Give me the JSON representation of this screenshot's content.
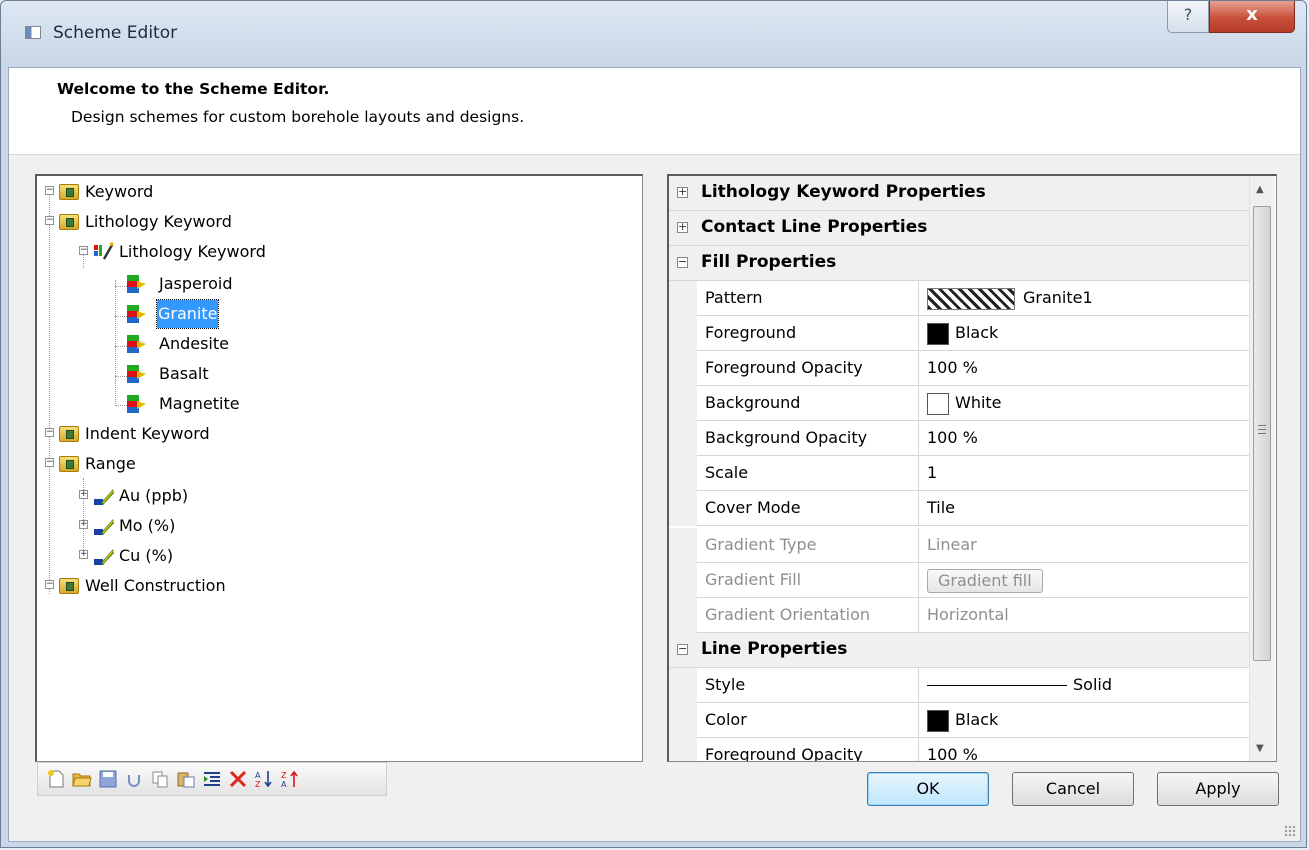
{
  "window": {
    "title": "Scheme Editor",
    "help_label": "?",
    "close_label": "x"
  },
  "header": {
    "title": "Welcome to the Scheme Editor.",
    "subtitle": "Design schemes for custom borehole layouts and designs."
  },
  "tree": {
    "keyword": "Keyword",
    "lithology_keyword": "Lithology Keyword",
    "lithology_keyword_child": "Lithology Keyword",
    "jasperoid": "Jasperoid",
    "granite": "Granite",
    "andesite": "Andesite",
    "basalt": "Basalt",
    "magnetite": "Magnetite",
    "indent_keyword": "Indent Keyword",
    "range": "Range",
    "au": "Au (ppb)",
    "mo": "Mo (%)",
    "cu": "Cu (%)",
    "well_construction": "Well Construction"
  },
  "properties": {
    "cat_lithology": "Lithology Keyword Properties",
    "cat_contact": "Contact Line Properties",
    "cat_fill": "Fill Properties",
    "cat_line": "Line Properties",
    "expand_symbol": "+",
    "collapse_symbol": "−",
    "fill": {
      "pattern_label": "Pattern",
      "pattern_value": "Granite1",
      "foreground_label": "Foreground",
      "foreground_value": "Black",
      "fg_opacity_label": "Foreground Opacity",
      "fg_opacity_value": "100 %",
      "background_label": "Background",
      "background_value": "White",
      "bg_opacity_label": "Background Opacity",
      "bg_opacity_value": "100 %",
      "scale_label": "Scale",
      "scale_value": "1",
      "cover_mode_label": "Cover Mode",
      "cover_mode_value": "Tile",
      "gradient_type_label": "Gradient Type",
      "gradient_type_value": "Linear",
      "gradient_fill_label": "Gradient Fill",
      "gradient_fill_button": "Gradient fill",
      "gradient_orientation_label": "Gradient Orientation",
      "gradient_orientation_value": "Horizontal"
    },
    "line": {
      "style_label": "Style",
      "style_value": "Solid",
      "color_label": "Color",
      "color_value": "Black",
      "fg_opacity_label": "Foreground Opacity",
      "fg_opacity_value": "100 %"
    },
    "colors": {
      "black": "#000000",
      "white": "#ffffff"
    }
  },
  "toolbar": {
    "icons": [
      "new-icon",
      "open-icon",
      "save-icon",
      "undo-icon",
      "copy-icon",
      "paste-icon",
      "indent-icon",
      "delete-icon",
      "sort-ascending-icon",
      "sort-descending-icon"
    ]
  },
  "buttons": {
    "ok": "OK",
    "cancel": "Cancel",
    "apply": "Apply"
  }
}
